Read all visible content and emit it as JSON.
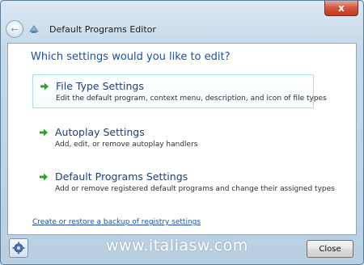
{
  "window": {
    "title": "Default Programs Editor",
    "close_glyph": "x"
  },
  "content": {
    "heading": "Which settings would you like to edit?",
    "options": [
      {
        "title": "File Type Settings",
        "description": "Edit the default program, context menu, description, and icon of file types",
        "icon": "green-arrow-icon"
      },
      {
        "title": "Autoplay Settings",
        "description": "Add, edit, or remove autoplay handlers",
        "icon": "green-arrow-icon"
      },
      {
        "title": "Default Programs Settings",
        "description": "Add or remove registered default programs and change their assigned types",
        "icon": "green-arrow-icon"
      }
    ],
    "backup_link": "Create or restore a backup of registry settings"
  },
  "footer": {
    "watermark": "www.italiasw.com",
    "close_label": "Close",
    "settings_icon": "gear-icon"
  },
  "colors": {
    "heading": "#1e4fa1",
    "arrow": "#2fa12a",
    "close_red": "#c4371d"
  }
}
